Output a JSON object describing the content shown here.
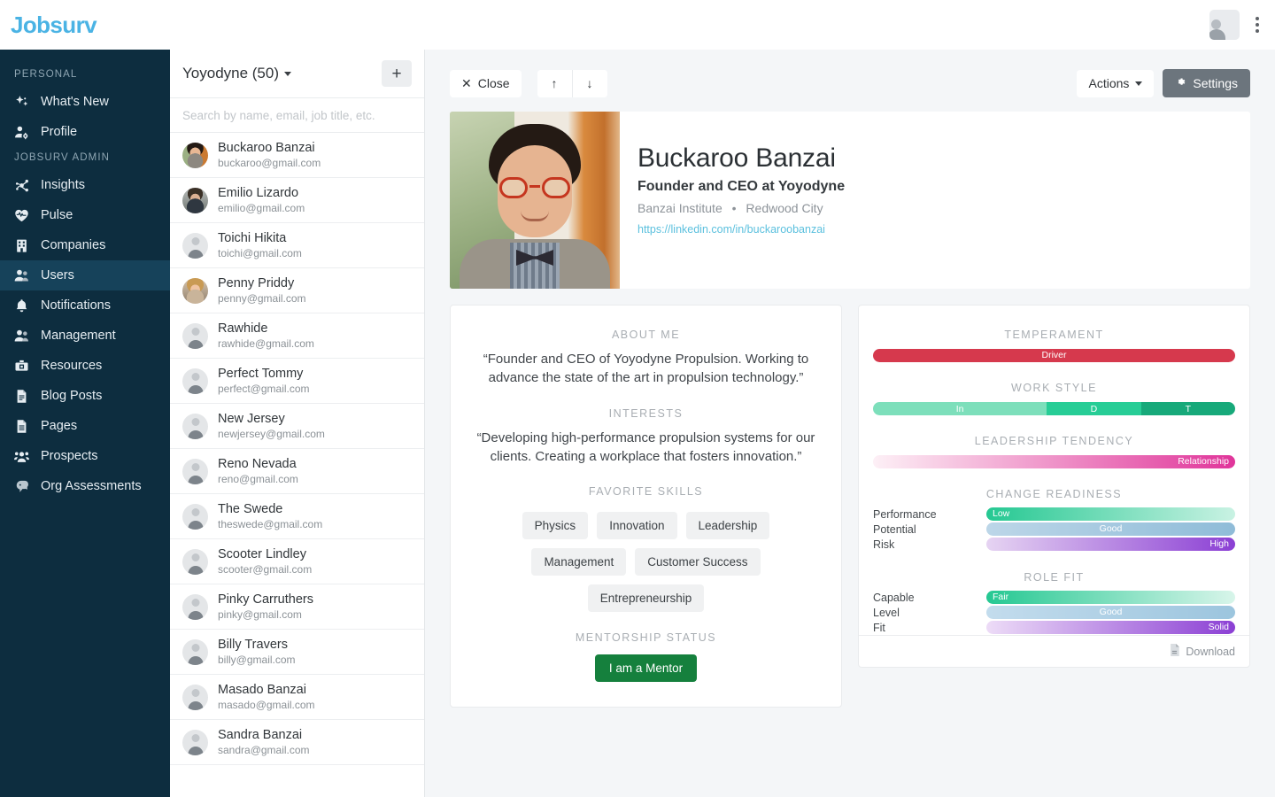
{
  "app": {
    "logo": "Jobsurv"
  },
  "topbar": {
    "avatar_icon": "user-avatar-icon",
    "menu_icon": "kebab-menu-icon"
  },
  "sidebar": {
    "groups": [
      {
        "label": "PERSONAL",
        "items": [
          {
            "label": "What's New",
            "icon": "sparkle-icon",
            "active": false
          },
          {
            "label": "Profile",
            "icon": "user-gear-icon",
            "active": false
          }
        ]
      },
      {
        "label": "JOBSURV ADMIN",
        "items": [
          {
            "label": "Insights",
            "icon": "network-icon",
            "active": false
          },
          {
            "label": "Pulse",
            "icon": "heart-pulse-icon",
            "active": false
          },
          {
            "label": "Companies",
            "icon": "building-icon",
            "active": false
          },
          {
            "label": "Users",
            "icon": "users-icon",
            "active": true
          },
          {
            "label": "Notifications",
            "icon": "bell-icon",
            "active": false
          },
          {
            "label": "Management",
            "icon": "users-icon",
            "active": false
          },
          {
            "label": "Resources",
            "icon": "toolbox-icon",
            "active": false
          },
          {
            "label": "Blog Posts",
            "icon": "document-icon",
            "active": false
          },
          {
            "label": "Pages",
            "icon": "page-icon",
            "active": false
          },
          {
            "label": "Prospects",
            "icon": "user-group-icon",
            "active": false
          },
          {
            "label": "Org Assessments",
            "icon": "brain-icon",
            "active": false
          }
        ]
      }
    ]
  },
  "list_panel": {
    "org_label": "Yoyodyne (50)",
    "add_button_label": "+",
    "search_placeholder": "Search by name, email, job title, etc.",
    "search_value": "",
    "users": [
      {
        "name": "Buckaroo Banzai",
        "email": "buckaroo@gmail.com",
        "has_photo": true,
        "photo": "photo-buckaroo"
      },
      {
        "name": "Emilio Lizardo",
        "email": "emilio@gmail.com",
        "has_photo": true,
        "photo": "photo-emilio"
      },
      {
        "name": "Toichi Hikita",
        "email": "toichi@gmail.com",
        "has_photo": false,
        "photo": ""
      },
      {
        "name": "Penny Priddy",
        "email": "penny@gmail.com",
        "has_photo": true,
        "photo": "photo-penny"
      },
      {
        "name": "Rawhide",
        "email": "rawhide@gmail.com",
        "has_photo": false,
        "photo": ""
      },
      {
        "name": "Perfect Tommy",
        "email": "perfect@gmail.com",
        "has_photo": false,
        "photo": ""
      },
      {
        "name": "New Jersey",
        "email": "newjersey@gmail.com",
        "has_photo": false,
        "photo": ""
      },
      {
        "name": "Reno Nevada",
        "email": "reno@gmail.com",
        "has_photo": false,
        "photo": ""
      },
      {
        "name": "The Swede",
        "email": "theswede@gmail.com",
        "has_photo": false,
        "photo": ""
      },
      {
        "name": "Scooter Lindley",
        "email": "scooter@gmail.com",
        "has_photo": false,
        "photo": ""
      },
      {
        "name": "Pinky Carruthers",
        "email": "pinky@gmail.com",
        "has_photo": false,
        "photo": ""
      },
      {
        "name": "Billy Travers",
        "email": "billy@gmail.com",
        "has_photo": false,
        "photo": ""
      },
      {
        "name": "Masado Banzai",
        "email": "masado@gmail.com",
        "has_photo": false,
        "photo": ""
      },
      {
        "name": "Sandra Banzai",
        "email": "sandra@gmail.com",
        "has_photo": false,
        "photo": ""
      }
    ]
  },
  "toolbar": {
    "close_label": "Close",
    "close_icon": "close-x-icon",
    "prev_icon": "arrow-up-icon",
    "next_icon": "arrow-down-icon",
    "actions_label": "Actions",
    "settings_label": "Settings",
    "settings_icon": "gear-icon"
  },
  "profile": {
    "name": "Buckaroo Banzai",
    "title": "Founder and CEO at Yoyodyne",
    "company": "Banzai Institute",
    "separator": "•",
    "location": "Redwood City",
    "link": "https://linkedin.com/in/buckaroobanzai",
    "photo_alt": "photo-buckaroo-banzai"
  },
  "left_card": {
    "about_heading": "About Me",
    "about_text": "“Founder and CEO of Yoyodyne Propulsion. Working to advance the state of the art in propulsion technology.”",
    "interests_heading": "Interests",
    "interests_text": "“Developing high-performance propulsion systems for our clients. Creating a workplace that fosters innovation.”",
    "skills_heading": "Favorite Skills",
    "skills": [
      "Physics",
      "Innovation",
      "Leadership",
      "Management",
      "Customer Success",
      "Entrepreneurship"
    ],
    "mentorship_heading": "Mentorship Status",
    "mentorship_status": "I am a Mentor",
    "mentorship_color": "#15803d"
  },
  "right_card": {
    "temperament": {
      "heading": "Temperament",
      "value": "Driver",
      "color": "#d6394d",
      "label_position": "center"
    },
    "work_style": {
      "heading": "Work Style",
      "segments": [
        {
          "label": "In",
          "percent": 48,
          "color": "#7ddfbb"
        },
        {
          "label": "D",
          "percent": 26,
          "color": "#27cd96"
        },
        {
          "label": "T",
          "percent": 26,
          "color": "#17a97a"
        }
      ]
    },
    "leadership_tendency": {
      "heading": "Leadership Tendency",
      "value": "Relationship",
      "gradient_from": "#fdf0f6",
      "gradient_to": "#e0359a",
      "label_position": "right"
    },
    "change_readiness": {
      "heading": "Change Readiness",
      "rows": [
        {
          "name": "Performance",
          "value": "Low",
          "label_position": "left",
          "gradient_from": "#25c892",
          "gradient_to": "#c9f2e3"
        },
        {
          "name": "Potential",
          "value": "Good",
          "label_position": "center",
          "gradient_from": "#bcd6e8",
          "gradient_to": "#8fbcd8"
        },
        {
          "name": "Risk",
          "value": "High",
          "label_position": "right",
          "gradient_from": "#e6d4f2",
          "gradient_to": "#8b3fd4"
        }
      ]
    },
    "role_fit": {
      "heading": "Role Fit",
      "rows": [
        {
          "name": "Capable",
          "value": "Fair",
          "label_position": "left",
          "gradient_from": "#25c892",
          "gradient_to": "#d8f5ea"
        },
        {
          "name": "Level",
          "value": "Good",
          "label_position": "center",
          "gradient_from": "#c3dced",
          "gradient_to": "#9cc5de"
        },
        {
          "name": "Fit",
          "value": "Solid",
          "label_position": "right",
          "gradient_from": "#eddcf7",
          "gradient_to": "#8b3fd4"
        }
      ]
    },
    "download_label": "Download",
    "download_icon": "download-file-icon"
  }
}
